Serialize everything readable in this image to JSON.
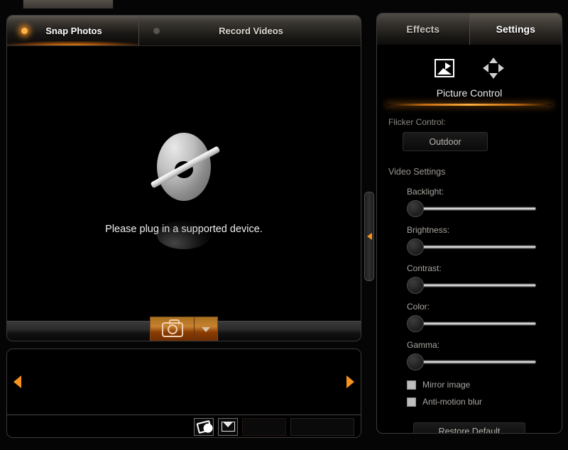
{
  "window": {
    "stub_title": ""
  },
  "left": {
    "tabs": [
      {
        "label": "Snap Photos",
        "active": true,
        "dot": "status-dot"
      },
      {
        "label": "Record Videos",
        "active": false,
        "dot": "status-dot"
      }
    ],
    "preview": {
      "icon": "no-device-icon",
      "message": "Please plug in a supported device."
    },
    "capture": {
      "button_icon": "camera-icon",
      "dropdown_icon": "chevron-down-icon"
    },
    "filmstrip": {
      "prev_icon": "arrow-left-icon",
      "next_icon": "arrow-right-icon",
      "toolbar": [
        {
          "name": "film-reel-button",
          "icon": "film-reel-icon",
          "label": ""
        },
        {
          "name": "email-button",
          "icon": "envelope-icon",
          "label": ""
        },
        {
          "name": "disabled-button-1",
          "icon": "",
          "label": ""
        },
        {
          "name": "disabled-button-2",
          "icon": "",
          "label": ""
        }
      ]
    },
    "collapse_handle": {
      "icon": "arrow-left-icon"
    }
  },
  "right": {
    "tabs": [
      {
        "label": "Effects",
        "active": false
      },
      {
        "label": "Settings",
        "active": true
      }
    ],
    "mode_icons": [
      {
        "name": "picture-control-icon",
        "active": true
      },
      {
        "name": "pan-tilt-icon",
        "active": false
      }
    ],
    "section_title": "Picture Control",
    "flicker": {
      "label": "Flicker Control:",
      "value": "Outdoor"
    },
    "video_settings": {
      "title": "Video Settings",
      "sliders": [
        {
          "label": "Backlight:",
          "value": 0
        },
        {
          "label": "Brightness:",
          "value": 0
        },
        {
          "label": "Contrast:",
          "value": 0
        },
        {
          "label": "Color:",
          "value": 0
        },
        {
          "label": "Gamma:",
          "value": 0
        }
      ],
      "checkboxes": [
        {
          "label": "Mirror image",
          "checked": false
        },
        {
          "label": "Anti-motion blur",
          "checked": false
        }
      ],
      "restore_label": "Restore Default"
    }
  },
  "colors": {
    "accent_orange": "#f7921e",
    "tab_gradient_top": "#56524c",
    "panel_bg": "#000000",
    "slider_track": "#f2f2f2"
  }
}
